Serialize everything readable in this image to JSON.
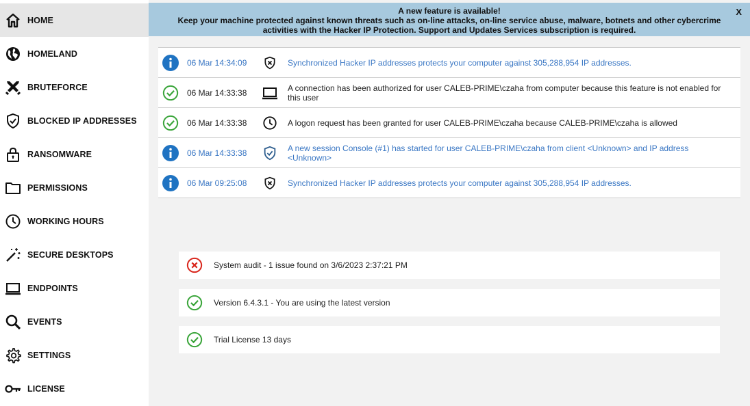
{
  "sidebar": {
    "items": [
      {
        "label": "HOME",
        "icon": "home-icon",
        "active": true
      },
      {
        "label": "HOMELAND",
        "icon": "globe-icon"
      },
      {
        "label": "BRUTEFORCE",
        "icon": "crossed-swords-icon"
      },
      {
        "label": "BLOCKED IP ADDRESSES",
        "icon": "shield-check-icon"
      },
      {
        "label": "RANSOMWARE",
        "icon": "lock-icon"
      },
      {
        "label": "PERMISSIONS",
        "icon": "folder-icon"
      },
      {
        "label": "WORKING HOURS",
        "icon": "clock-icon"
      },
      {
        "label": "SECURE DESKTOPS",
        "icon": "magic-wand-icon"
      },
      {
        "label": "ENDPOINTS",
        "icon": "laptop-icon"
      },
      {
        "label": "EVENTS",
        "icon": "magnifier-icon"
      },
      {
        "label": "SETTINGS",
        "icon": "gear-icon"
      },
      {
        "label": "LICENSE",
        "icon": "key-icon"
      }
    ]
  },
  "banner": {
    "title": "A new feature is available!",
    "text": "Keep your machine protected against known threats such as on-line attacks, on-line service abuse, malware, botnets and other cybercrime activities with the Hacker IP Protection. Support and Updates Services subscription is required.",
    "close_label": "X"
  },
  "events": [
    {
      "status": "info",
      "time": "06 Mar 14:34:09",
      "type_icon": "shield-x-icon",
      "message": "Synchronized Hacker IP addresses protects your computer against 305,288,954 IP addresses."
    },
    {
      "status": "success",
      "time": "06 Mar 14:33:38",
      "type_icon": "laptop-icon",
      "message": "A connection has been authorized for user CALEB-PRIME\\czaha from computer  because this feature is not enabled for this user"
    },
    {
      "status": "success",
      "time": "06 Mar 14:33:38",
      "type_icon": "clock-icon",
      "message": "A logon request has been granted for user CALEB-PRIME\\czaha because CALEB-PRIME\\czaha is allowed"
    },
    {
      "status": "info",
      "time": "06 Mar 14:33:38",
      "type_icon": "shield-check-icon",
      "message": "A new session Console (#1) has started for user CALEB-PRIME\\czaha from client <Unknown> and IP address <Unknown>"
    },
    {
      "status": "info",
      "time": "06 Mar 09:25:08",
      "type_icon": "shield-x-icon",
      "message": "Synchronized Hacker IP addresses protects your computer against 305,288,954 IP addresses."
    }
  ],
  "status_cards": [
    {
      "status": "error",
      "text": "System audit - 1 issue found on 3/6/2023 2:37:21 PM"
    },
    {
      "status": "success",
      "text": "Version 6.4.3.1 - You are using the latest version"
    },
    {
      "status": "success",
      "text": "Trial License 13 days"
    }
  ],
  "colors": {
    "banner_bg": "#a7c9de",
    "info_blue": "#1f73c2",
    "info_text": "#3a77c4",
    "success_green": "#3aa53a",
    "error_red": "#d9261c"
  }
}
